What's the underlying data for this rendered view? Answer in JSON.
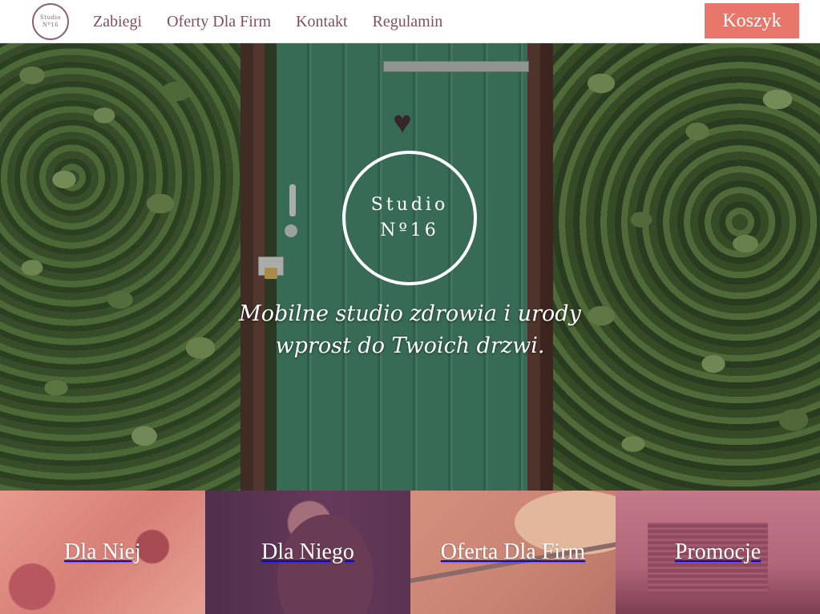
{
  "header": {
    "logo": {
      "line1": "Studio",
      "line2": "Nº16"
    },
    "nav": [
      {
        "label": "Zabiegi"
      },
      {
        "label": "Oferty Dla Firm"
      },
      {
        "label": "Kontakt"
      },
      {
        "label": "Regulamin"
      }
    ],
    "cart_label": "Koszyk"
  },
  "hero": {
    "brand_line1": "Studio",
    "brand_line2": "Nº16",
    "tagline_line1": "Mobilne studio zdrowia i urody",
    "tagline_line2": "wprost do Twoich drzwi."
  },
  "tiles": [
    {
      "label": "Dla Niej"
    },
    {
      "label": "Dla Niego"
    },
    {
      "label": "Oferta Dla Firm"
    },
    {
      "label": "Promocje"
    }
  ],
  "colors": {
    "accent": "#e8766a",
    "nav_text": "#7d4f5f",
    "tile_dla_niej": "#e0887d",
    "tile_dla_niego": "#5a3452",
    "tile_oferta": "#d08a78",
    "tile_promocje": "#b5687c"
  }
}
